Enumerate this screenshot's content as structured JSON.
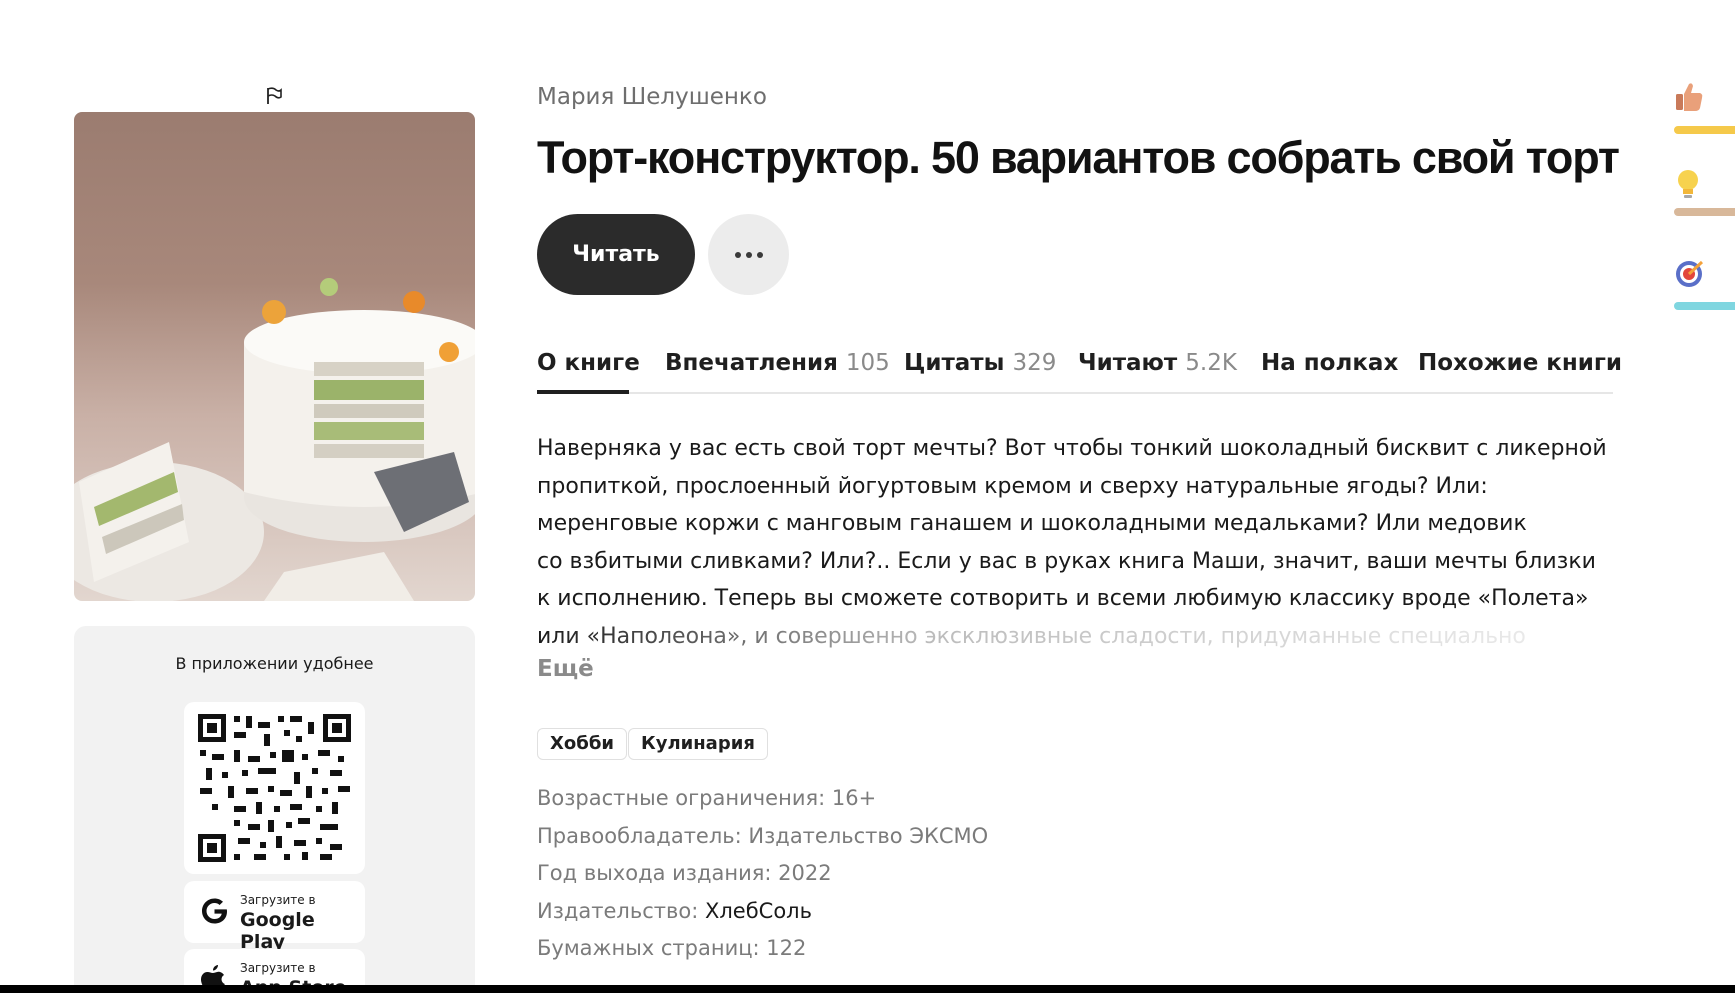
{
  "book": {
    "author": "Мария Шелушенко",
    "title": "Торт-конструктор. 50 вариантов собрать свой торт"
  },
  "actions": {
    "read_label": "Читать"
  },
  "tabs": [
    {
      "label": "О книге",
      "count": ""
    },
    {
      "label": "Впечатления",
      "count": "105"
    },
    {
      "label": "Цитаты",
      "count": "329"
    },
    {
      "label": "Читают",
      "count": "5.2K"
    },
    {
      "label": "На полках",
      "count": ""
    },
    {
      "label": "Похожие книги",
      "count": ""
    }
  ],
  "description": {
    "lines": [
      "Наверняка у вас есть свой торт мечты? Вот чтобы тонкий шоколадный бисквит с ликерной",
      "пропиткой, прослоенный йогуртовым кремом и сверху натуральные ягоды? Или:",
      "меренговые коржи с манговым ганашем и шоколадными медальками? Или медовик",
      "со взбитыми сливками? Или?.. Если у вас в руках книга Маши, значит, ваши мечты близки",
      "к исполнению. Теперь вы сможете сотворить и всеми любимую классику вроде «Полета»",
      "или «Наполеона», и совершенно эксклюзивные сладости, придуманные специально"
    ],
    "more_label": "Ещё"
  },
  "tags": [
    "Хобби",
    "Кулинария"
  ],
  "meta": {
    "age_label": "Возрастные ограничения:",
    "age_value": "16+",
    "rights_label": "Правообладатель:",
    "rights_value": "Издательство ЭКСМО",
    "year_label": "Год выхода издания:",
    "year_value": "2022",
    "publisher_label": "Издательство:",
    "publisher_value": "ХлебСоль",
    "pages_label": "Бумажных страниц:",
    "pages_value": "122"
  },
  "app_promo": {
    "title": "В приложении удобнее",
    "google_pre": "Загрузите в",
    "google_name": "Google Play",
    "apple_pre": "Загрузите в",
    "apple_name": "App Store"
  },
  "rail": [
    {
      "icon": "thumbs-up-icon",
      "bar_color": "#f5c94a"
    },
    {
      "icon": "lightbulb-icon",
      "bar_color": "#d8b89a"
    },
    {
      "icon": "target-icon",
      "bar_color": "#7fd6e0"
    }
  ]
}
